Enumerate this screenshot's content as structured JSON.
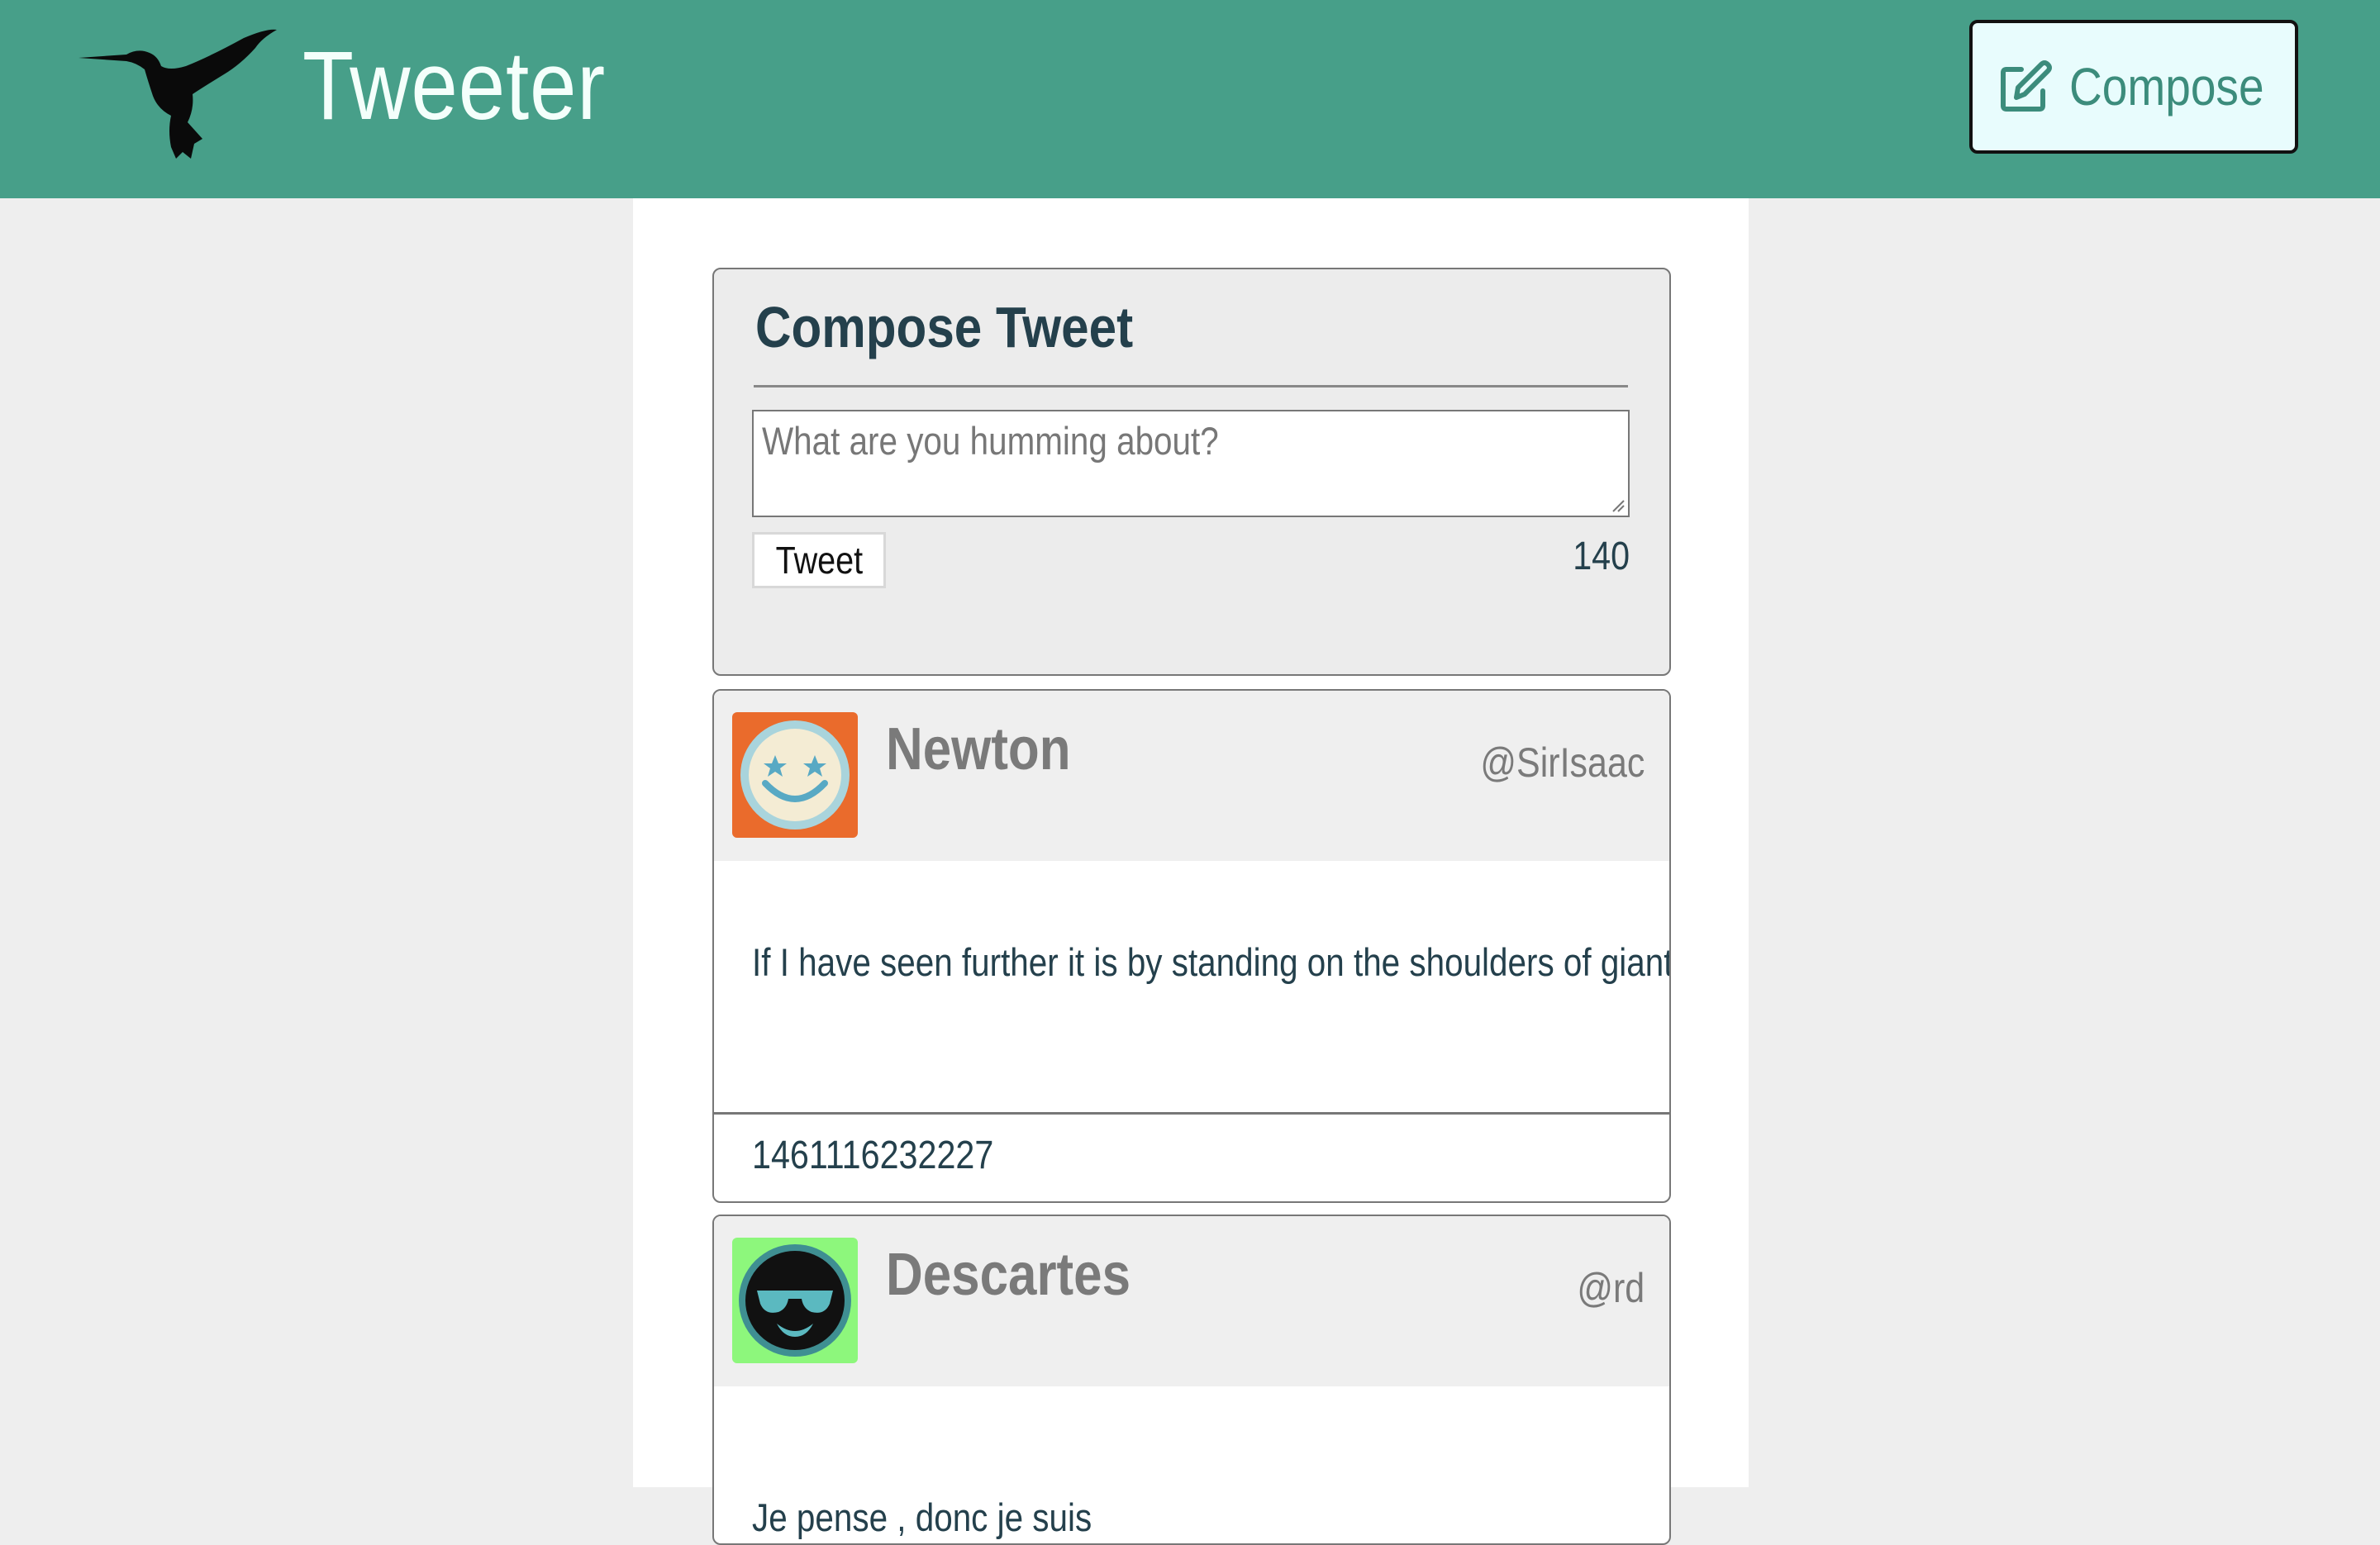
{
  "navbar": {
    "brand": "Tweeter",
    "compose_label": "Compose",
    "brand_color": "#479f89"
  },
  "compose": {
    "title": "Compose Tweet",
    "placeholder": "What are you humming about?",
    "tweet_button": "Tweet",
    "char_count": "140"
  },
  "tweets": [
    {
      "name": "Newton",
      "handle": "@SirIsaac",
      "text": "If I have seen further it is by standing on the shoulders of giants",
      "timestamp": "1461116232227",
      "avatar_bg": "#ea6b2c"
    },
    {
      "name": "Descartes",
      "handle": "@rd",
      "text": "Je pense , donc je suis",
      "avatar_bg": "#8df77c"
    }
  ]
}
